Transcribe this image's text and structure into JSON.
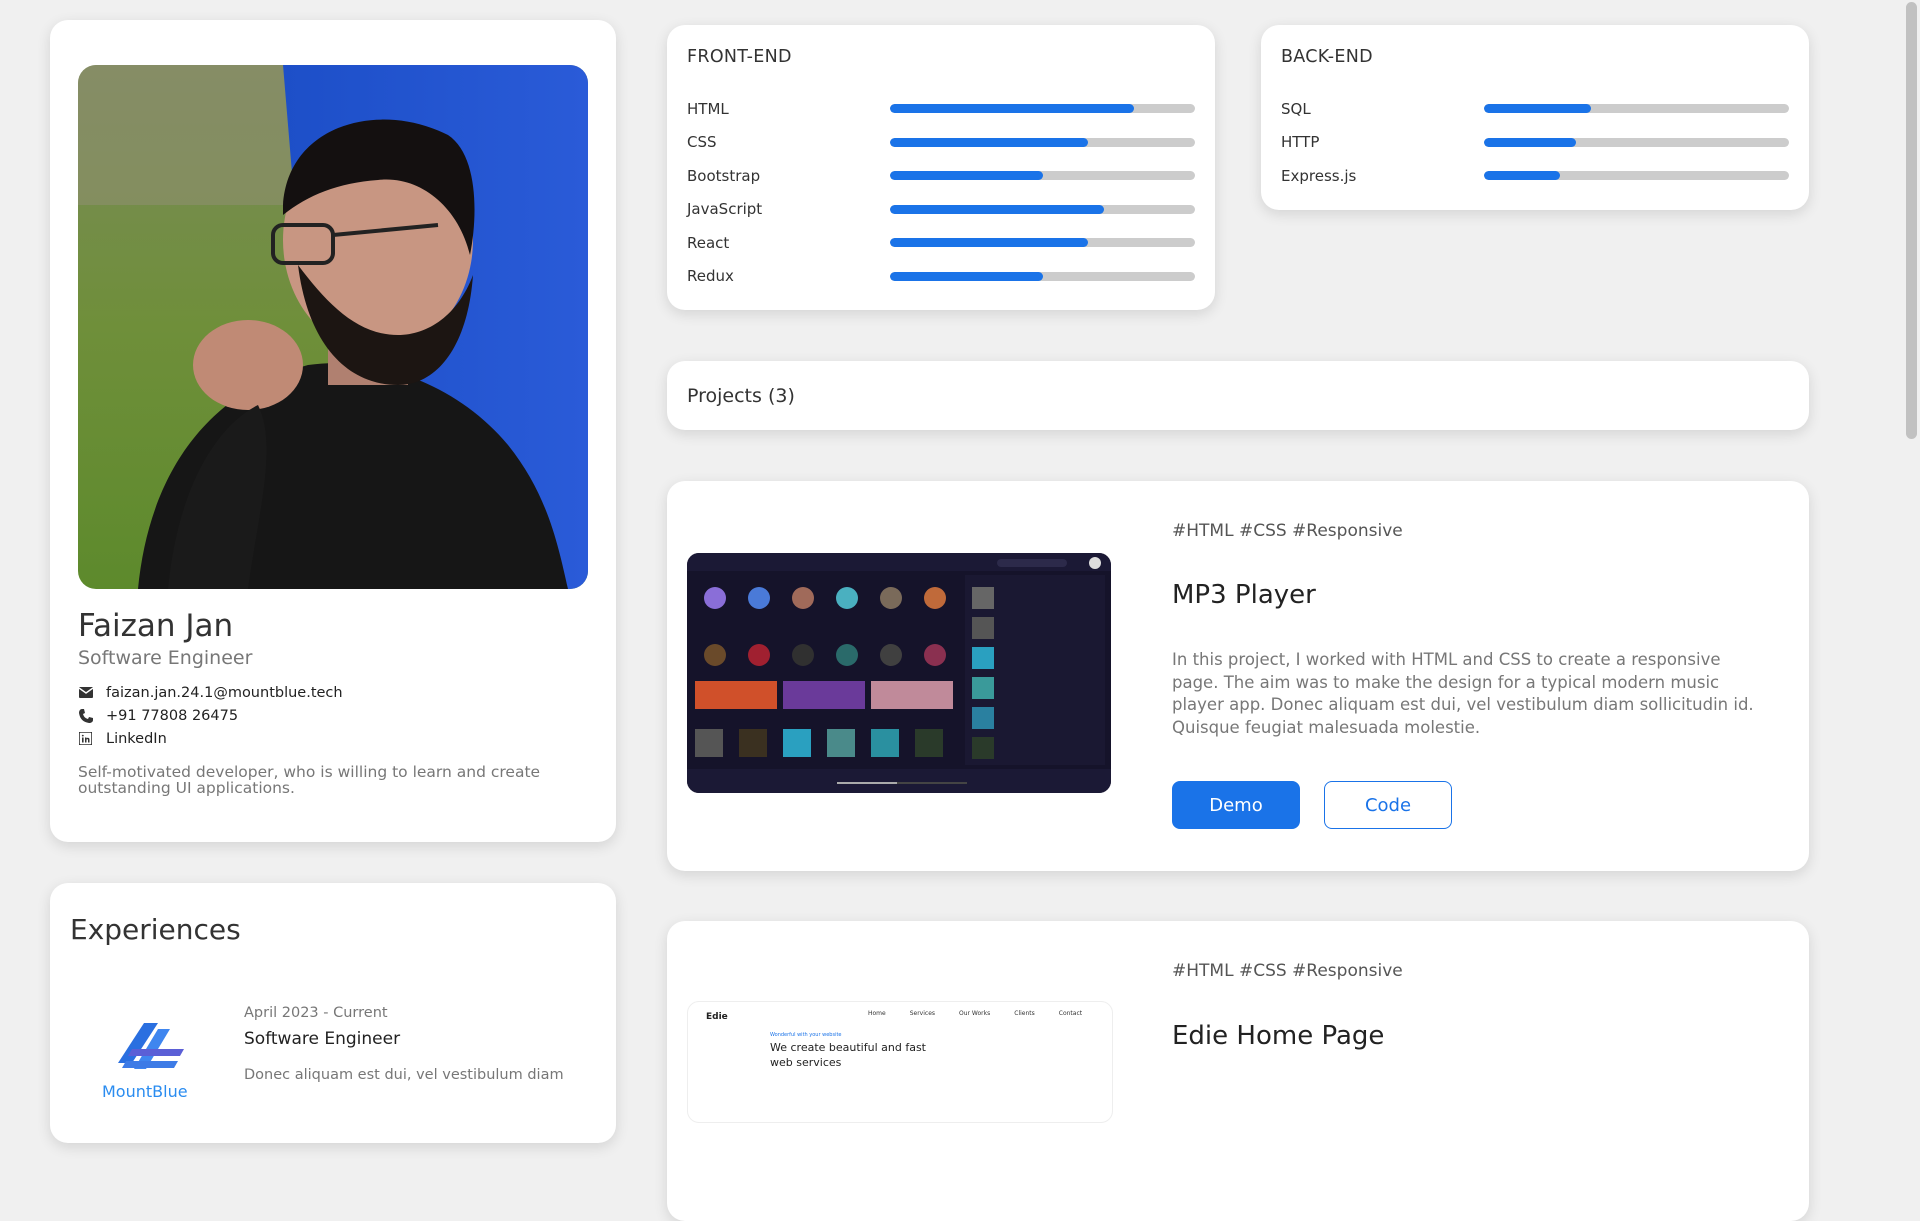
{
  "profile": {
    "name": "Faizan Jan",
    "role": "Software Engineer",
    "email": "faizan.jan.24.1@mountblue.tech",
    "phone": "+91 77808 26475",
    "linkedin": "LinkedIn",
    "bio": "Self-motivated developer, who is willing to learn and create outstanding UI applications."
  },
  "experiences": {
    "title": "Experiences",
    "items": [
      {
        "company_logo_text": "MountBlue",
        "date": "April 2023 - Current",
        "role": "Software Engineer",
        "description": "Donec aliquam est dui, vel vestibulum diam"
      }
    ]
  },
  "frontend": {
    "title": "FRONT-END",
    "skills": [
      {
        "name": "HTML",
        "level": 0.8
      },
      {
        "name": "CSS",
        "level": 0.65
      },
      {
        "name": "Bootstrap",
        "level": 0.5
      },
      {
        "name": "JavaScript",
        "level": 0.7
      },
      {
        "name": "React",
        "level": 0.65
      },
      {
        "name": "Redux",
        "level": 0.5
      }
    ]
  },
  "backend": {
    "title": "BACK-END",
    "skills": [
      {
        "name": "SQL",
        "level": 0.35
      },
      {
        "name": "HTTP",
        "level": 0.3
      },
      {
        "name": "Express.js",
        "level": 0.25
      }
    ]
  },
  "projects": {
    "header": "Projects (3)",
    "items": [
      {
        "tags": "#HTML #CSS #Responsive",
        "title": "MP3 Player",
        "description": "In this project, I worked with HTML and CSS to create a responsive page. The aim was to make the design for a typical modern music player app. Donec aliquam est dui, vel vestibulum diam sollicitudin id. Quisque feugiat malesuada molestie.",
        "demo_label": "Demo",
        "code_label": "Code"
      },
      {
        "tags": "#HTML #CSS #Responsive",
        "title": "Edie Home Page",
        "thumb_brand": "Edie",
        "thumb_nav": [
          "Home",
          "Services",
          "Our Works",
          "Clients",
          "Contact"
        ],
        "thumb_small": "Wonderful with your website",
        "thumb_heading": "We create beautiful and fast web services"
      }
    ]
  },
  "colors": {
    "accent": "#1a73e8",
    "bar_track": "#cccccc",
    "background": "#f0f0f0"
  }
}
